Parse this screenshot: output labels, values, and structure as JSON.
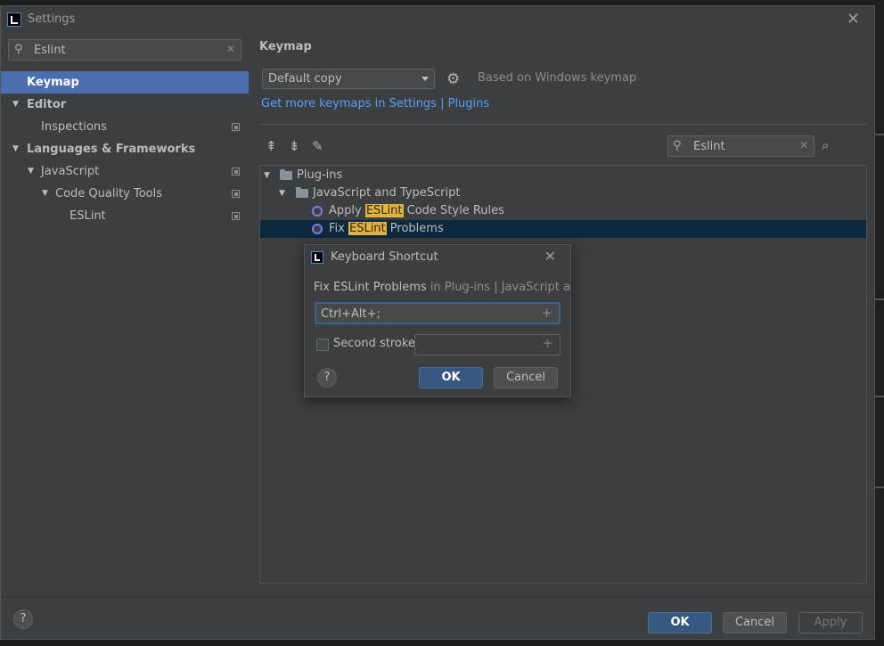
{
  "window": {
    "title": "Settings"
  },
  "sidebar": {
    "search_value": "Eslint",
    "items": [
      {
        "label": "Keymap"
      },
      {
        "label": "Editor"
      },
      {
        "label": "Inspections"
      },
      {
        "label": "Languages & Frameworks"
      },
      {
        "label": "JavaScript"
      },
      {
        "label": "Code Quality Tools"
      },
      {
        "label": "ESLint"
      }
    ]
  },
  "content": {
    "title": "Keymap",
    "keymap_selected": "Default copy",
    "based_on": "Based on Windows keymap",
    "get_more_link": "Get more keymaps in Settings | Plugins",
    "filter_value": "Eslint",
    "tree": {
      "plugins": "Plug-ins",
      "js_ts": "JavaScript and TypeScript",
      "apply_prefix": "Apply ",
      "apply_match": "ESLint",
      "apply_suffix": " Code Style Rules",
      "fix_prefix": "Fix ",
      "fix_match": "ESLint",
      "fix_suffix": " Problems"
    }
  },
  "dialog": {
    "title": "Keyboard Shortcut",
    "action_name": "Fix ESLint Problems",
    "action_path": " in Plug-ins | JavaScript and TypeScript",
    "shortcut_value": "Ctrl+Alt+;",
    "second_stroke_label": "Second stroke:",
    "ok": "OK",
    "cancel": "Cancel",
    "help": "?"
  },
  "footer": {
    "help": "?",
    "ok": "OK",
    "cancel": "Cancel",
    "apply": "Apply"
  }
}
